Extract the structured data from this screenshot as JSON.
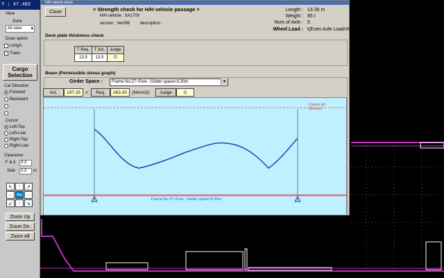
{
  "coord": {
    "y_label": "Y : 47.403"
  },
  "left_panel": {
    "view_label": "View",
    "zone_label": "Zone",
    "zone_value": "All view",
    "draw_option_label": "Draw option",
    "draw_options": [
      "Long/L",
      "Trans"
    ],
    "cargo_selection": "Cargo Selection",
    "car_direction_label": "Car Direction",
    "car_directions": [
      "Forward",
      "Backward"
    ],
    "cursor_label": "Cursor",
    "cursor_options": [
      "Left-Top",
      "Left-Low",
      "Right-Top",
      "Right-Low"
    ],
    "clearance_label": "Clearance",
    "fa_label": "F & A",
    "fa_value": "0.3",
    "side_label": "Side",
    "side_value": "0.3",
    "side_unit": "m",
    "zoom_up": "Zoom Up",
    "zoom_dn": "Zoom Dn.",
    "zoom_all": "Zoom All",
    "arrow_center": "Fix"
  },
  "dialog": {
    "title": "H/H vehicle check",
    "close_label": "Close",
    "heading": "< Strength check for H/H vehicle passage >",
    "vehicle_line": "H/H vehicle : SA1700",
    "version_line": "version : Ver006",
    "description_label": "description :",
    "length_label": "Length :",
    "length_value": "13.35 m",
    "weight_label": "Weight :",
    "weight_value": "85 t",
    "axle_label": "Num of Axle :",
    "axle_value": "5",
    "wheel_label": "Wheel Load :",
    "wheel_value": "t(Even Axle Load=No)",
    "deck_label": "Deck plate thickness check",
    "thickness": {
      "h1": "T Req.",
      "h2": "T Act.",
      "h3": "Judge",
      "v1": "13.5",
      "v2": "13.5",
      "v3": "O"
    },
    "beam_label": "Beam (Permissible stress graph)",
    "girder_label": "Girder Space :",
    "girder_value": "Frame No.27~Fore : Girder space=3.20m",
    "act_label": "Act.",
    "act_value": "197.25",
    "lt": "<",
    "req_label": "Req.",
    "req_value": "263.00",
    "unit": "(N/mm2)",
    "judge_label": "Judge",
    "judge_value": "O",
    "sigma_label_1": "(Sigma all)",
    "sigma_label_2": "(N/mm2)",
    "frame_caption": "Frame No.27~Fore : Girder space=3.20m"
  },
  "colors": {
    "curve": "#2040b0",
    "baseline": "#e07080",
    "allow_line": "#e04040",
    "plot_bg": "#bff0ff",
    "outline": "#c000c0"
  }
}
